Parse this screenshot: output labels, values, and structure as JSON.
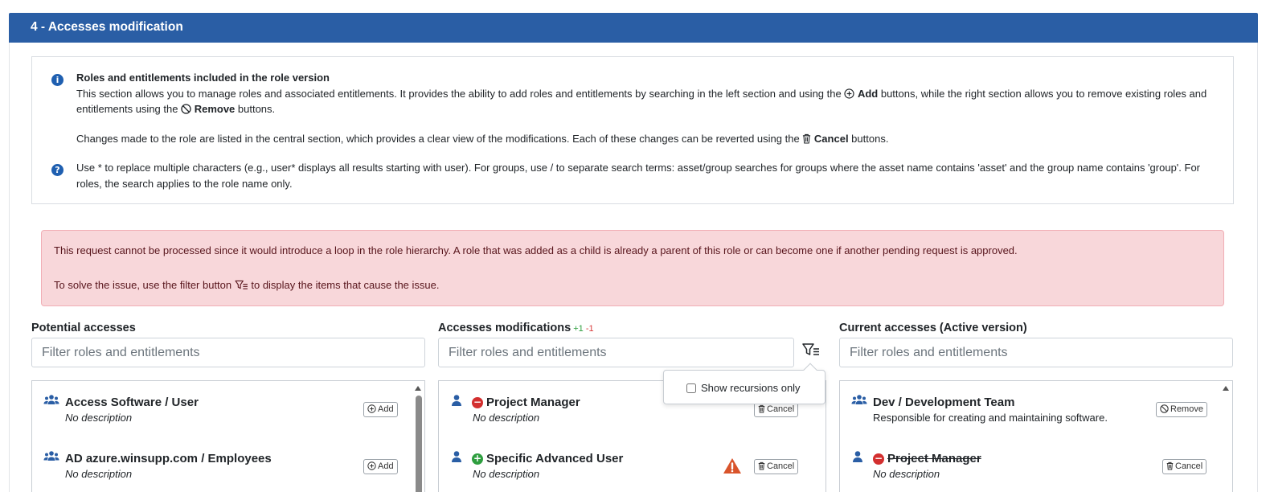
{
  "section": {
    "title": "4 - Accesses modification"
  },
  "info": {
    "title": "Roles and entitlements included in the role version",
    "p1_before": "This section allows you to manage roles and associated entitlements. It provides the ability to add roles and entitlements by searching in the left section and using the ",
    "p1_add": "Add",
    "p1_middle": " buttons, while the right section allows you to remove existing roles and entitlements using the ",
    "p1_remove": "Remove",
    "p1_after": " buttons.",
    "p2_before": "Changes made to the role are listed in the central section, which provides a clear view of the modifications. Each of these changes can be reverted using the ",
    "p2_cancel": "Cancel",
    "p2_after": " buttons.",
    "help": "Use * to replace multiple characters (e.g., user* displays all results starting with user). For groups, use / to separate search terms: asset/group searches for groups where the asset name contains 'asset' and the group name contains 'group'. For roles, the search applies to the role name only."
  },
  "alert": {
    "line1": "This request cannot be processed since it would introduce a loop in the role hierarchy. A role that was added as a child is already a parent of this role or can become one if another pending request is approved.",
    "line2_before": "To solve the issue, use the filter button ",
    "line2_after": " to display the items that cause the issue."
  },
  "columns": {
    "potential": {
      "title": "Potential accesses",
      "placeholder": "Filter roles and entitlements",
      "items": [
        {
          "name": "Access Software / User",
          "desc": "No description",
          "icon": "group-icon",
          "button": "Add"
        },
        {
          "name": "AD azure.winsupp.com / Employees",
          "desc": "No description",
          "icon": "group-icon",
          "button": "Add"
        }
      ]
    },
    "modifications": {
      "title": "Accesses modifications",
      "added": "+1",
      "removed": "-1",
      "placeholder": "Filter roles and entitlements",
      "items": [
        {
          "name": "Project Manager",
          "desc": "No description",
          "icon": "user-icon",
          "status": "removed",
          "button": "Cancel"
        },
        {
          "name": "Specific Advanced User",
          "desc": "No description",
          "icon": "user-icon",
          "status": "added",
          "button": "Cancel",
          "warning": true
        }
      ]
    },
    "current": {
      "title": "Current accesses (Active version)",
      "placeholder": "Filter roles and entitlements",
      "items": [
        {
          "name": "Dev / Development Team",
          "desc": "Responsible for creating and maintaining software.",
          "icon": "group-icon",
          "button": "Remove"
        },
        {
          "name": "Project Manager",
          "desc": "No description",
          "icon": "user-icon",
          "status": "removed",
          "button": "Cancel"
        }
      ]
    }
  },
  "dropdown": {
    "label": "Show recursions only",
    "checked": false
  },
  "colors": {
    "header": "#2a5ea5",
    "alert_bg": "#f8d7da",
    "accent_blue": "#1f5fb0",
    "added": "#2e9e3f",
    "removed": "#d32f2f",
    "warning": "#d9542b"
  }
}
